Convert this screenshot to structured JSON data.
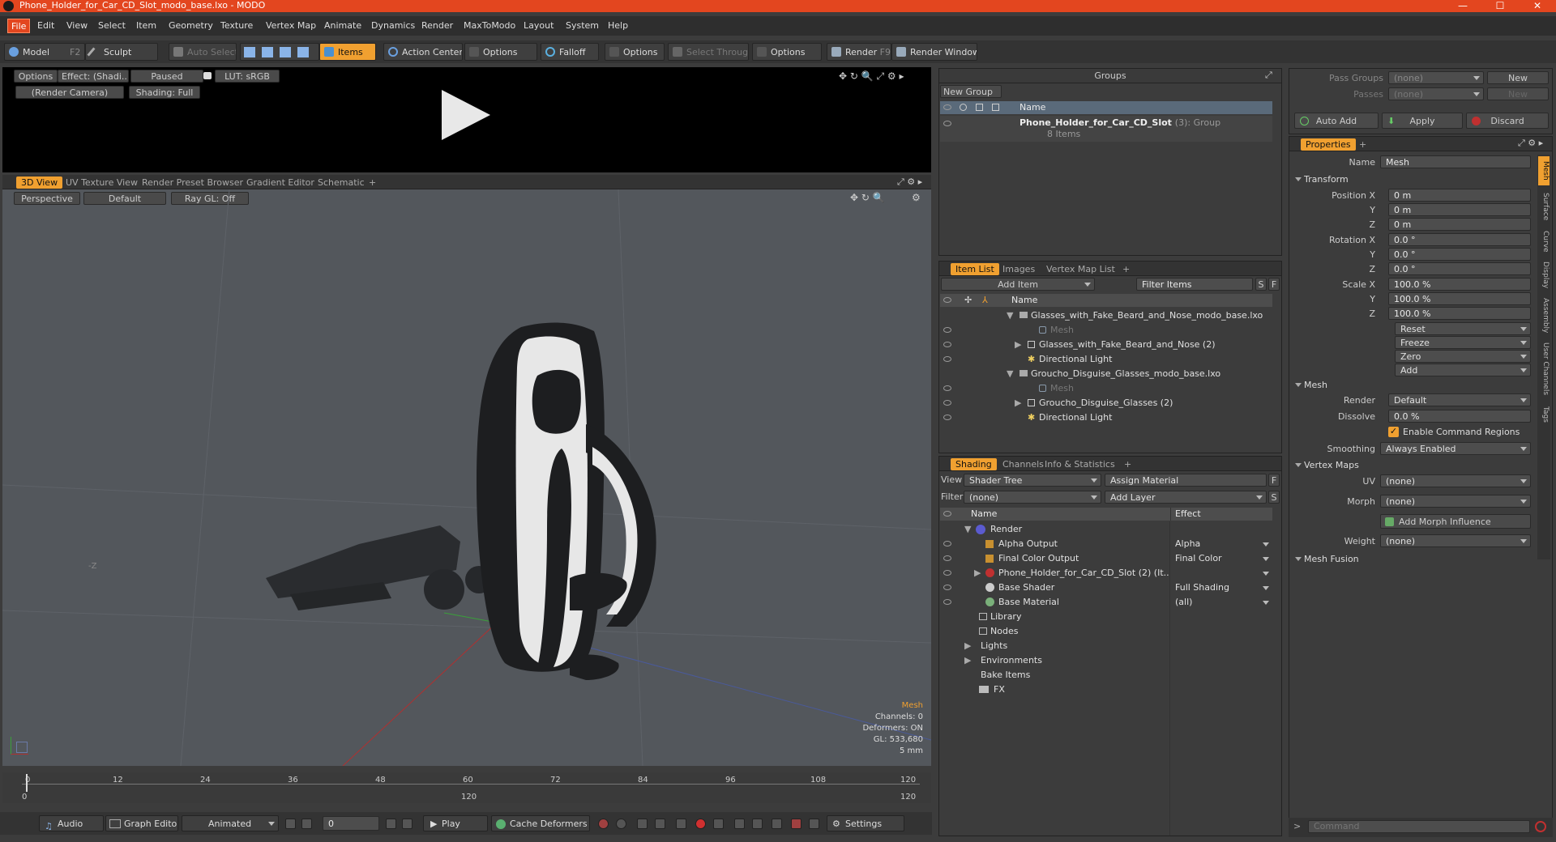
{
  "window": {
    "title": "Phone_Holder_for_Car_CD_Slot_modo_base.lxo - MODO",
    "min": "—",
    "max": "☐",
    "close": "✕"
  },
  "menu": [
    "File",
    "Edit",
    "View",
    "Select",
    "Item",
    "Geometry",
    "Texture",
    "Vertex Map",
    "Animate",
    "Dynamics",
    "Render",
    "MaxToModo",
    "Layout",
    "System",
    "Help"
  ],
  "toolbar": {
    "model": "Model",
    "model_key": "F2",
    "sculpt": "Sculpt",
    "auto_select": "Auto Select",
    "items": "Items",
    "action_center": "Action Center",
    "options1": "Options",
    "falloff": "Falloff",
    "options2": "Options",
    "select_through": "Select Through",
    "options3": "Options",
    "render": "Render",
    "render_key": "F9",
    "render_window": "Render Window"
  },
  "preview": {
    "options": "Options",
    "effect": "Effect: (Shadi...",
    "paused": "Paused",
    "lut": "LUT: sRGB",
    "camera": "(Render Camera)",
    "shading": "Shading: Full"
  },
  "viewtabs": {
    "tabs": [
      "3D View",
      "UV Texture View",
      "Render Preset Browser",
      "Gradient Editor",
      "Schematic"
    ],
    "plus": "+"
  },
  "viewport": {
    "perspective": "Perspective",
    "default": "Default",
    "raygl": "Ray GL: Off",
    "info_title": "Mesh",
    "channels": "Channels: 0",
    "deformers": "Deformers: ON",
    "gl": "GL: 533,680",
    "scale": "5 mm"
  },
  "timeline": {
    "ticks": [
      "0",
      "12",
      "24",
      "36",
      "48",
      "60",
      "72",
      "84",
      "96",
      "108",
      "120"
    ],
    "bottom_ticks": [
      "0",
      "120",
      "120"
    ]
  },
  "bottombar": {
    "audio": "Audio",
    "graph_editor": "Graph Editor",
    "animated": "Animated",
    "frame": "0",
    "play": "Play",
    "cache": "Cache Deformers",
    "settings": "Settings"
  },
  "groups": {
    "title": "Groups",
    "new_group": "New Group",
    "col_name": "Name",
    "item_name": "Phone_Holder_for_Car_CD_Slot",
    "item_count": "(3)",
    "item_type": ": Group",
    "item_sub": "8 Items"
  },
  "itemlist": {
    "tabs": [
      "Item List",
      "Images",
      "Vertex Map List"
    ],
    "plus": "+",
    "add_item": "Add Item",
    "filter": "Filter Items",
    "s": "S",
    "f": "F",
    "col_name": "Name",
    "rows": [
      {
        "text": "Glasses_with_Fake_Beard_and_Nose_modo_base.lxo",
        "indent": 0
      },
      {
        "text": "Mesh",
        "indent": 2
      },
      {
        "text": "Glasses_with_Fake_Beard_and_Nose (2)",
        "indent": 1
      },
      {
        "text": "Directional Light",
        "indent": 1
      },
      {
        "text": "Groucho_Disguise_Glasses_modo_base.lxo",
        "indent": 0
      },
      {
        "text": "Mesh",
        "indent": 2
      },
      {
        "text": "Groucho_Disguise_Glasses (2)",
        "indent": 1
      },
      {
        "text": "Directional Light",
        "indent": 1
      }
    ]
  },
  "shading": {
    "tabs": [
      "Shading",
      "Channels",
      "Info & Statistics"
    ],
    "plus": "+",
    "view_label": "View",
    "view_value": "Shader Tree",
    "assign_material": "Assign Material",
    "f": "F",
    "filter_label": "Filter",
    "filter_value": "(none)",
    "add_layer": "Add Layer",
    "s": "S",
    "col_name": "Name",
    "col_effect": "Effect",
    "rows": [
      {
        "name": "Render",
        "effect": ""
      },
      {
        "name": "Alpha Output",
        "effect": "Alpha"
      },
      {
        "name": "Final Color Output",
        "effect": "Final Color"
      },
      {
        "name": "Phone_Holder_for_Car_CD_Slot (2) (It...",
        "effect": ""
      },
      {
        "name": "Base Shader",
        "effect": "Full Shading"
      },
      {
        "name": "Base Material",
        "effect": "(all)"
      },
      {
        "name": "Library",
        "effect": ""
      },
      {
        "name": "Nodes",
        "effect": ""
      },
      {
        "name": "Lights",
        "effect": ""
      },
      {
        "name": "Environments",
        "effect": ""
      },
      {
        "name": "Bake Items",
        "effect": ""
      },
      {
        "name": "FX",
        "effect": ""
      }
    ]
  },
  "passes": {
    "pass_groups": "Pass Groups",
    "passes": "Passes",
    "none": "(none)",
    "new": "New",
    "auto_add": "Auto Add",
    "apply": "Apply",
    "discard": "Discard"
  },
  "properties": {
    "tab": "Properties",
    "plus": "+",
    "name_label": "Name",
    "name_value": "Mesh",
    "transform": "Transform",
    "pos_label": "Position X",
    "px": "0 m",
    "py": "0 m",
    "pz": "0 m",
    "rot_label": "Rotation X",
    "rx": "0.0 °",
    "ry": "0.0 °",
    "rz": "0.0 °",
    "scale_label": "Scale X",
    "sx": "100.0 %",
    "sy": "100.0 %",
    "sz": "100.0 %",
    "y": "Y",
    "z": "Z",
    "reset": "Reset",
    "freeze": "Freeze",
    "zero": "Zero",
    "add": "Add",
    "mesh": "Mesh",
    "render_label": "Render",
    "render_value": "Default",
    "dissolve_label": "Dissolve",
    "dissolve_value": "0.0 %",
    "enable_cmd": "Enable Command Regions",
    "smoothing_label": "Smoothing",
    "smoothing_value": "Always Enabled",
    "vertex_maps": "Vertex Maps",
    "uv_label": "UV",
    "uv_value": "(none)",
    "morph_label": "Morph",
    "morph_value": "(none)",
    "add_morph": "Add Morph Influence",
    "weight_label": "Weight",
    "weight_value": "(none)",
    "mesh_fusion": "Mesh Fusion",
    "side_tabs": [
      "Mesh",
      "Surface",
      "Curve",
      "Display",
      "Assembly",
      "User Channels",
      "Tags"
    ]
  },
  "command": {
    "placeholder": "Command"
  },
  "colors": {
    "accent": "#f0a030",
    "title": "#e3461f",
    "header": "#5a6a7a"
  }
}
